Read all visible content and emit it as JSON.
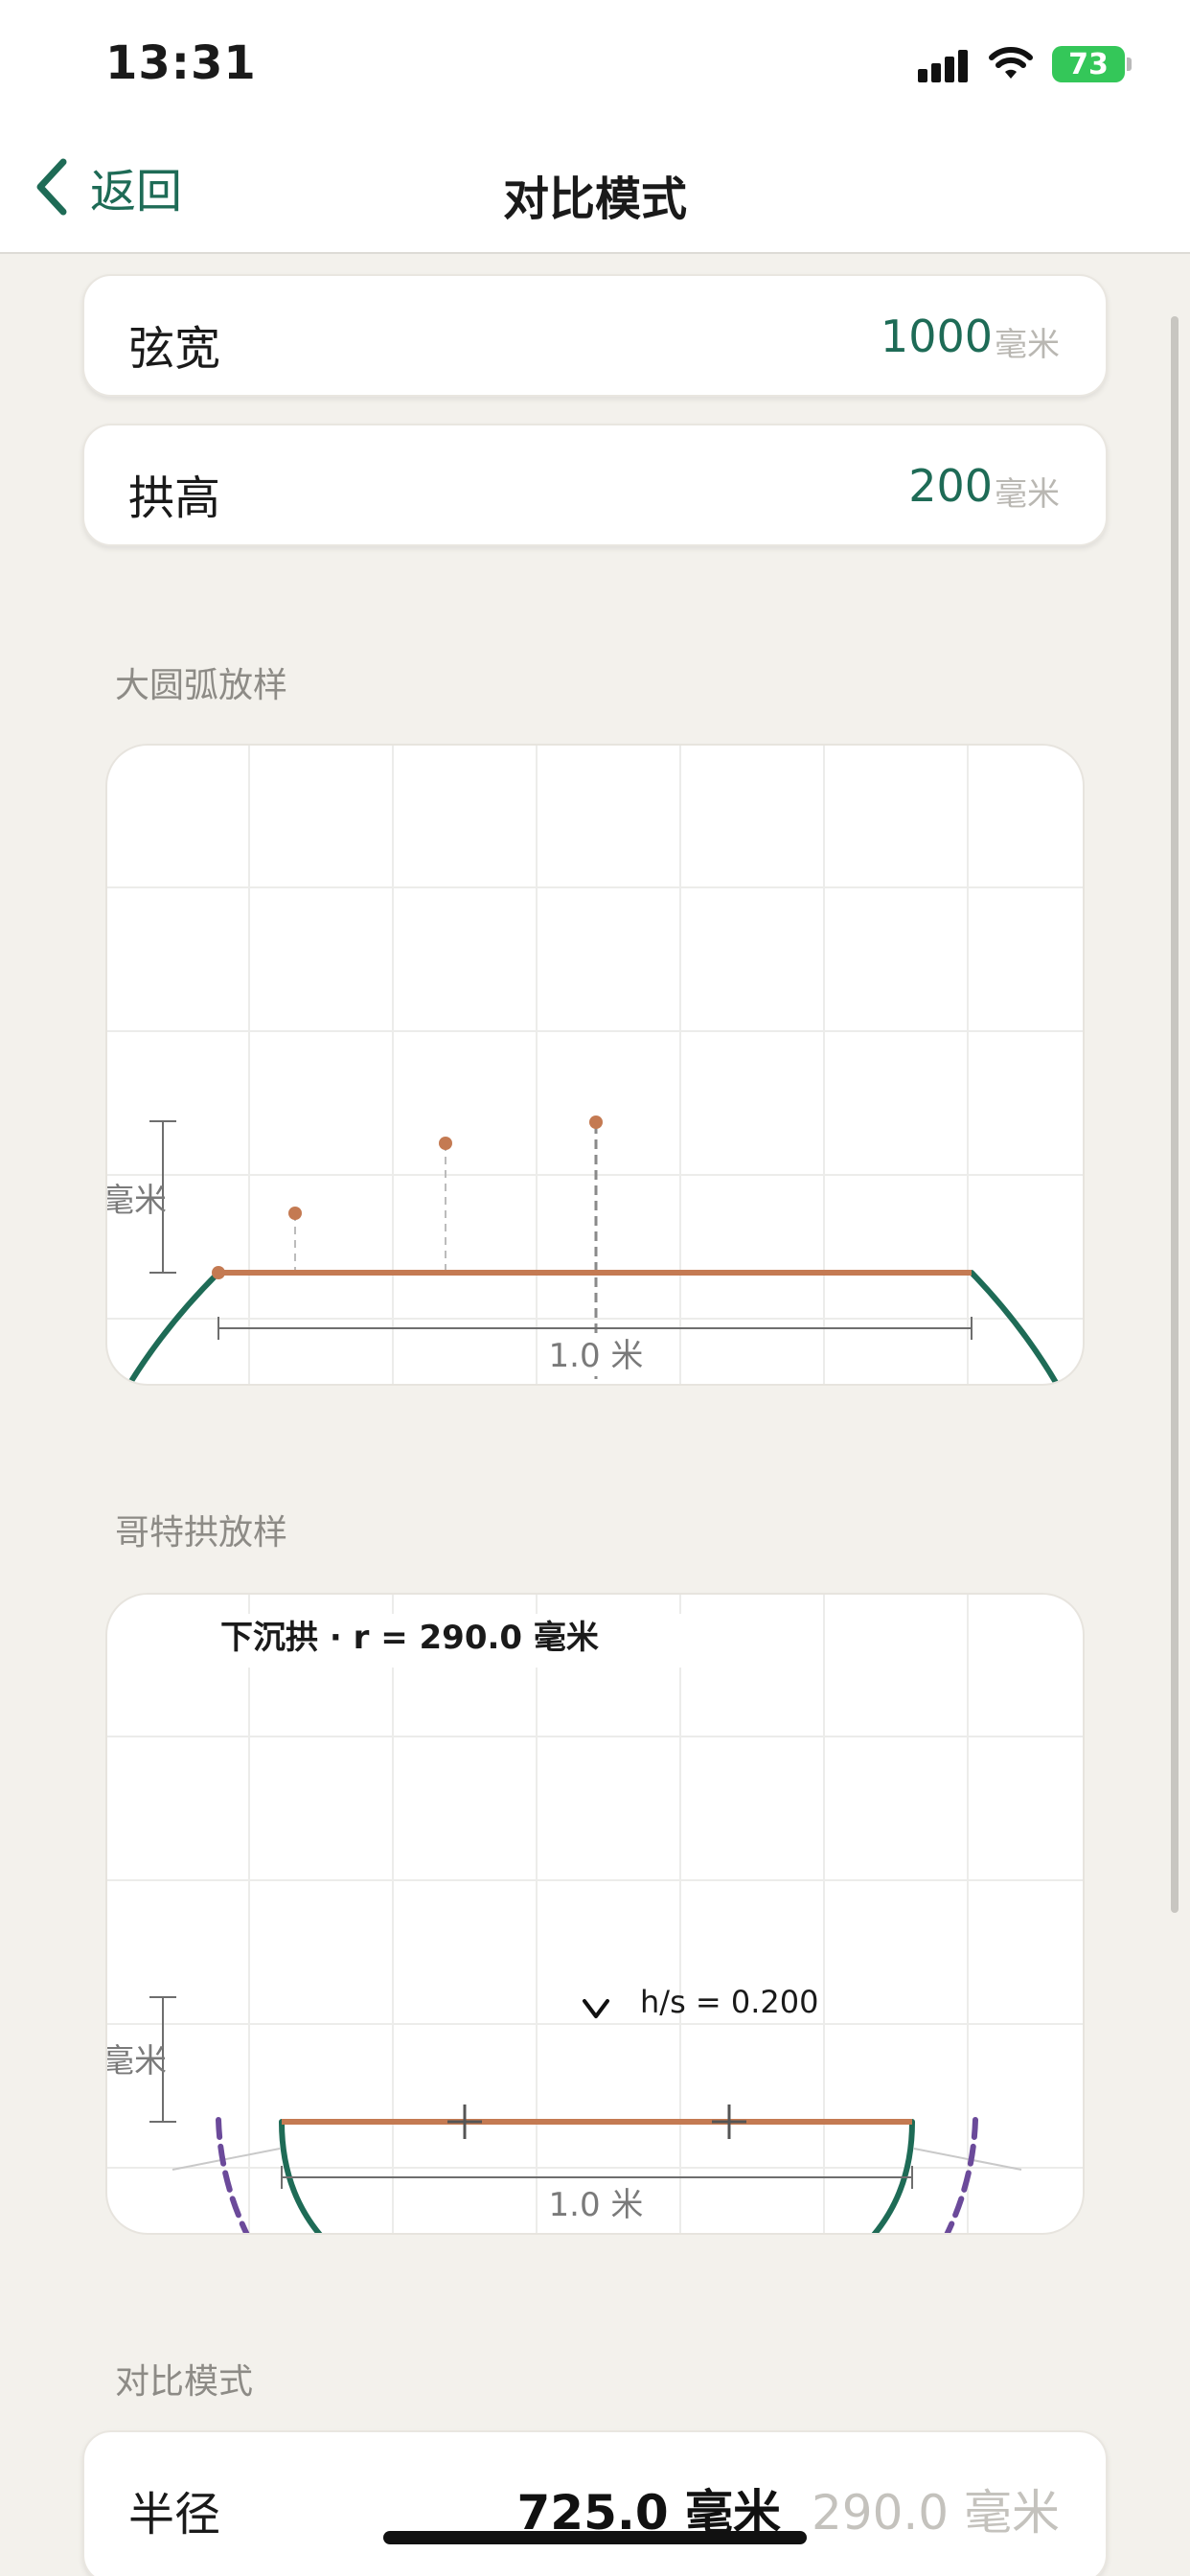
{
  "status": {
    "time": "13:31",
    "battery": "73"
  },
  "nav": {
    "back_label": "返回",
    "title": "对比模式"
  },
  "inputs": [
    {
      "label": "弦宽",
      "value": "1000",
      "unit": "毫米"
    },
    {
      "label": "拱高",
      "value": "200",
      "unit": "毫米"
    }
  ],
  "arc_section": {
    "title": "大圆弧放样",
    "height_label": "毫米",
    "span_label": "1.0 米"
  },
  "gothic_section": {
    "title": "哥特拱放样",
    "caption": "下沉拱 · r = 290.0 毫米",
    "ratio_label": "h/s = 0.200",
    "height_label": "毫米",
    "span_label": "1.0 米"
  },
  "compare_section": {
    "title": "对比模式",
    "row_label": "半径",
    "value_primary": "725.0 毫米",
    "value_secondary": "290.0 毫米"
  },
  "colors": {
    "accent": "#1e6b56",
    "chord": "#c47a52",
    "alt_curve": "#6b4a9a",
    "battery": "#34c759"
  },
  "icons": [
    "back-chevron-icon",
    "signal-icon",
    "wifi-icon",
    "battery-icon",
    "apex-chevron-icon"
  ]
}
